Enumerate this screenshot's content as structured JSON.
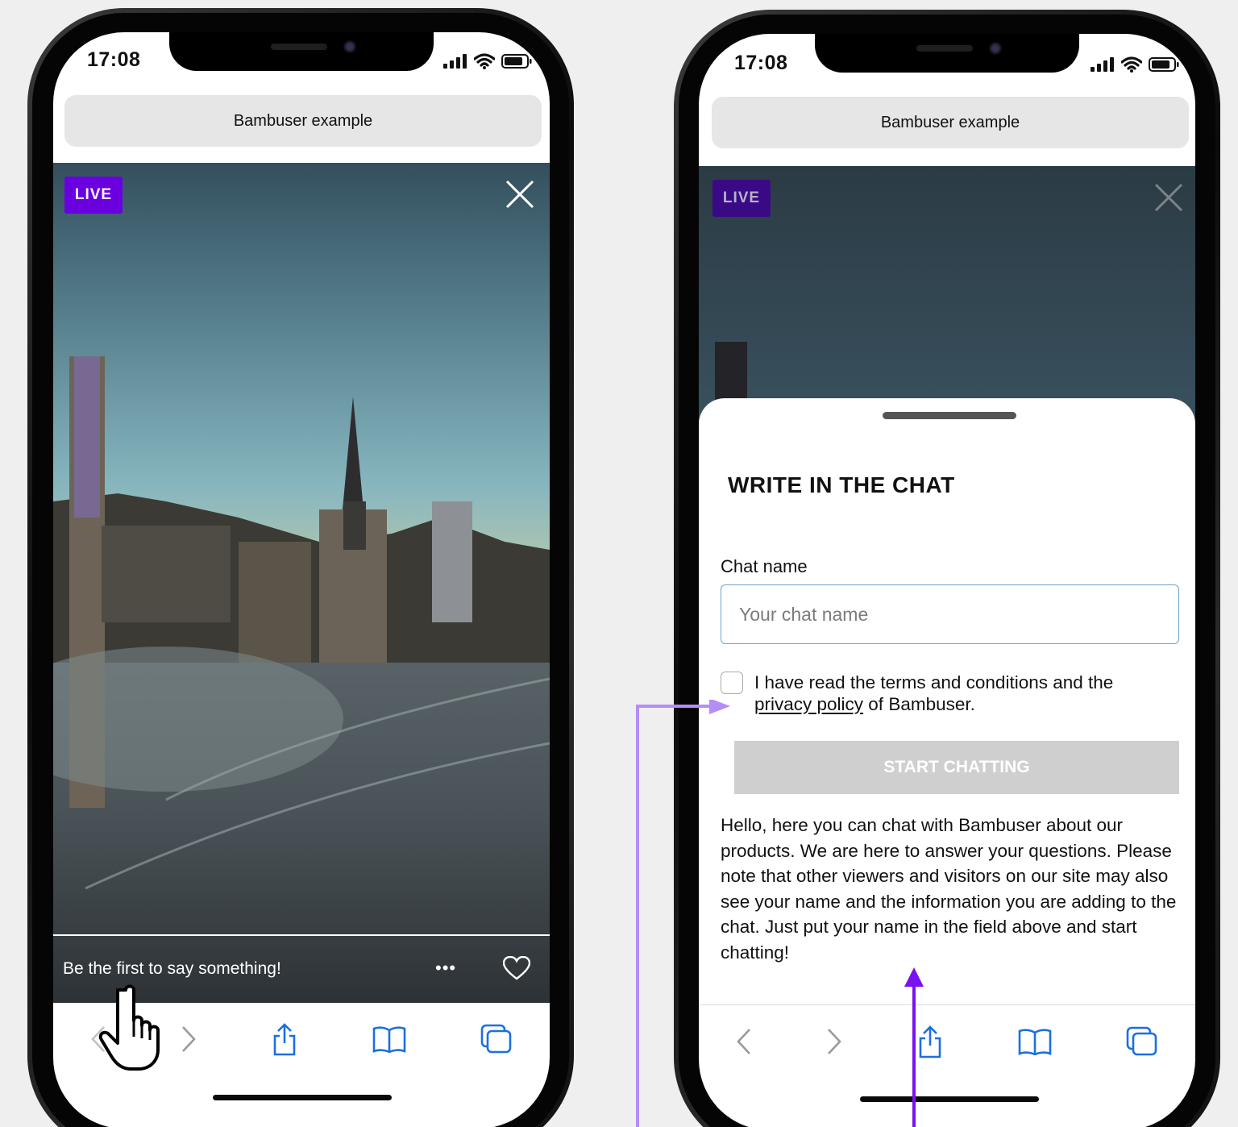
{
  "status": {
    "time": "17:08"
  },
  "browser": {
    "url_title": "Bambuser example"
  },
  "player": {
    "live_label": "LIVE",
    "chat_prompt": "Be the first to say something!",
    "more_label": "•••",
    "accent_color": "#6a00e0"
  },
  "chat_sheet": {
    "title": "WRITE IN THE CHAT",
    "name_label": "Chat name",
    "name_placeholder": "Your chat name",
    "consent_before": "I have read the terms and conditions and the",
    "consent_link": "privacy policy",
    "consent_after": " of Bambuser.",
    "start_button": "START CHATTING",
    "info": "Hello, here you can chat with Bambuser about our products. We are here to answer your questions. Please note that other viewers and visitors on our site may also see your name and the information you are adding to the chat. Just put your name in the field above and start chatting!"
  },
  "colors": {
    "arrow_light": "#b48df7",
    "arrow_dark": "#7a12f0",
    "button_disabled": "#cfcfcf"
  },
  "icons": [
    "back-chevron-icon",
    "forward-chevron-icon",
    "share-icon",
    "bookmarks-icon",
    "tabs-icon",
    "heart-icon",
    "close-icon",
    "signal-icon",
    "wifi-icon",
    "battery-icon",
    "hand-pointer-icon"
  ]
}
